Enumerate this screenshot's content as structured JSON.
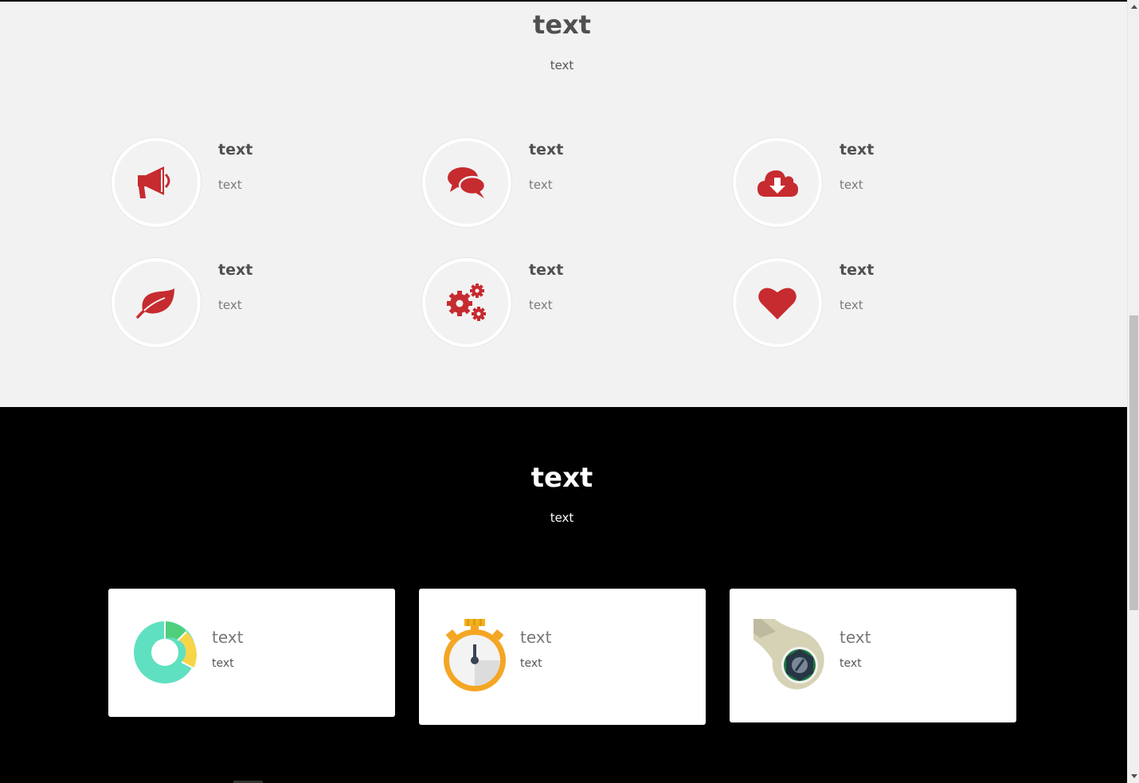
{
  "features": {
    "title": "text",
    "subtitle": "text",
    "items": [
      {
        "icon": "megaphone-icon",
        "title": "text",
        "text": "text"
      },
      {
        "icon": "chat-bubbles-icon",
        "title": "text",
        "text": "text"
      },
      {
        "icon": "cloud-download-icon",
        "title": "text",
        "text": "text"
      },
      {
        "icon": "leaf-icon",
        "title": "text",
        "text": "text"
      },
      {
        "icon": "gears-icon",
        "title": "text",
        "text": "text"
      },
      {
        "icon": "heart-icon",
        "title": "text",
        "text": "text"
      }
    ],
    "icon_color": "#c62b2f",
    "background": "#f2f2f2"
  },
  "services": {
    "title": "text",
    "subtitle": "text",
    "background": "#000000",
    "cards": [
      {
        "icon": "donut-chart-icon",
        "title": "text",
        "text": "text"
      },
      {
        "icon": "stopwatch-icon",
        "title": "text",
        "text": "text"
      },
      {
        "icon": "wrench-icon",
        "title": "text",
        "text": "text"
      }
    ]
  }
}
